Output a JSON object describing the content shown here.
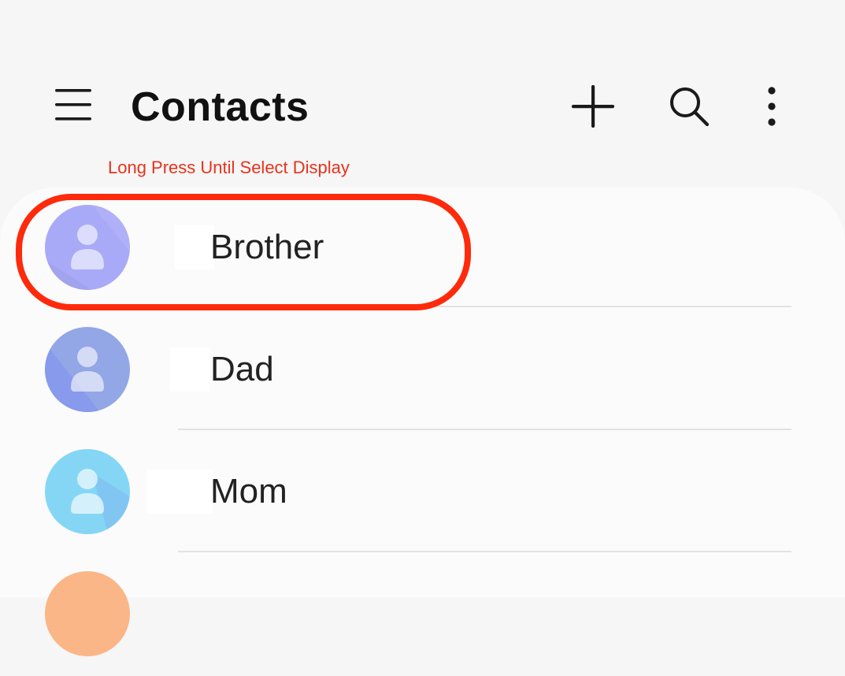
{
  "header": {
    "title": "Contacts",
    "menu_icon": "hamburger-menu-icon",
    "add_icon": "plus-icon",
    "search_icon": "search-icon",
    "more_icon": "more-vertical-icon"
  },
  "annotation": {
    "text": "Long Press Until Select Display",
    "color": "#e8321c",
    "highlight_color": "#fe2a0c"
  },
  "contacts": [
    {
      "name": "Brother",
      "avatar_color": "#a9aaf7"
    },
    {
      "name": "Dad",
      "avatar_color": "#8c9fe6"
    },
    {
      "name": "Mom",
      "avatar_color": "#85d6f4"
    },
    {
      "name": "",
      "avatar_color": "#fbb687"
    }
  ]
}
